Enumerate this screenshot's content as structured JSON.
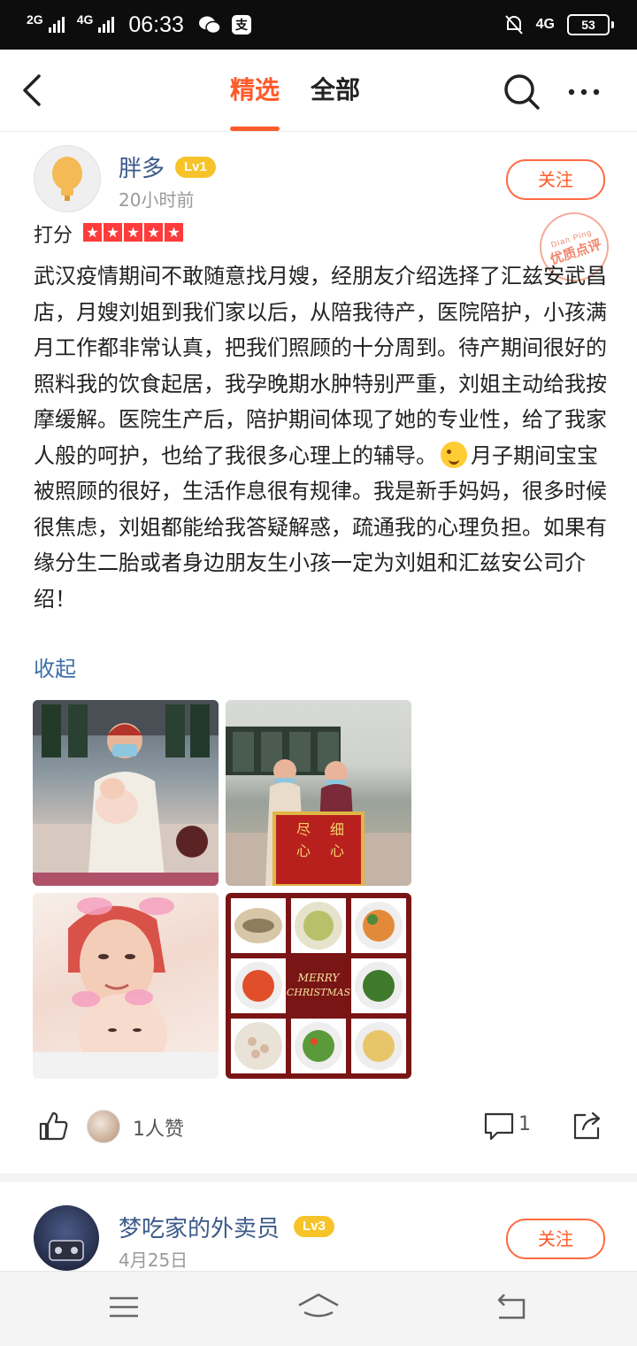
{
  "status_bar": {
    "net1": "2G",
    "net2": "4G",
    "net2_sup": "HD",
    "time": "06:33",
    "app_icon_text": "支",
    "right_net": "4G",
    "battery": "53"
  },
  "header": {
    "tab_selected": "精选",
    "tab_all": "全部"
  },
  "reviews": [
    {
      "username": "胖多",
      "level": "Lv1",
      "time": "20小时前",
      "follow_label": "关注",
      "score_label": "打分",
      "stars": 5,
      "stamp_small": "Dian Ping",
      "stamp_big": "优质点评",
      "text_part1": "武汉疫情期间不敢随意找月嫂，经朋友介绍选择了汇兹安武昌店，月嫂刘姐到我们家以后，从陪我待产，医院陪护，小孩满月工作都非常认真，把我们照顾的十分周到。待产期间很好的照料我的饮食起居，我孕晚期水肿特别严重，刘姐主动给我按摩缓解。医院生产后，陪护期间体现了她的专业性，给了我家人般的呵护，也给了我很多心理上的辅导。",
      "text_part2": "月子期间宝宝被照顾的很好，生活作息很有规律。我是新手妈妈，很多时候很焦虑，刘姐都能给我答疑解惑，疏通我的心理负担。如果有缘分生二胎或者身边朋友生小孩一定为刘姐和汇兹安公司介绍！",
      "collapse_label": "收起",
      "banner_text": [
        "尽",
        "细",
        "心",
        "心"
      ],
      "food_card_line1": "MERRY",
      "food_card_line2": "CHRISTMAS",
      "likes_label": "1人赞",
      "comments": "1"
    },
    {
      "username": "梦吃家的外卖员",
      "level": "Lv3",
      "time": "4月25日",
      "follow_label": "关注"
    }
  ],
  "colors": {
    "accent": "#ff5a2a",
    "link": "#3d6fa8",
    "username": "#3d5a8a",
    "level_badge": "#f6c42a",
    "star": "#ff3b3b"
  }
}
